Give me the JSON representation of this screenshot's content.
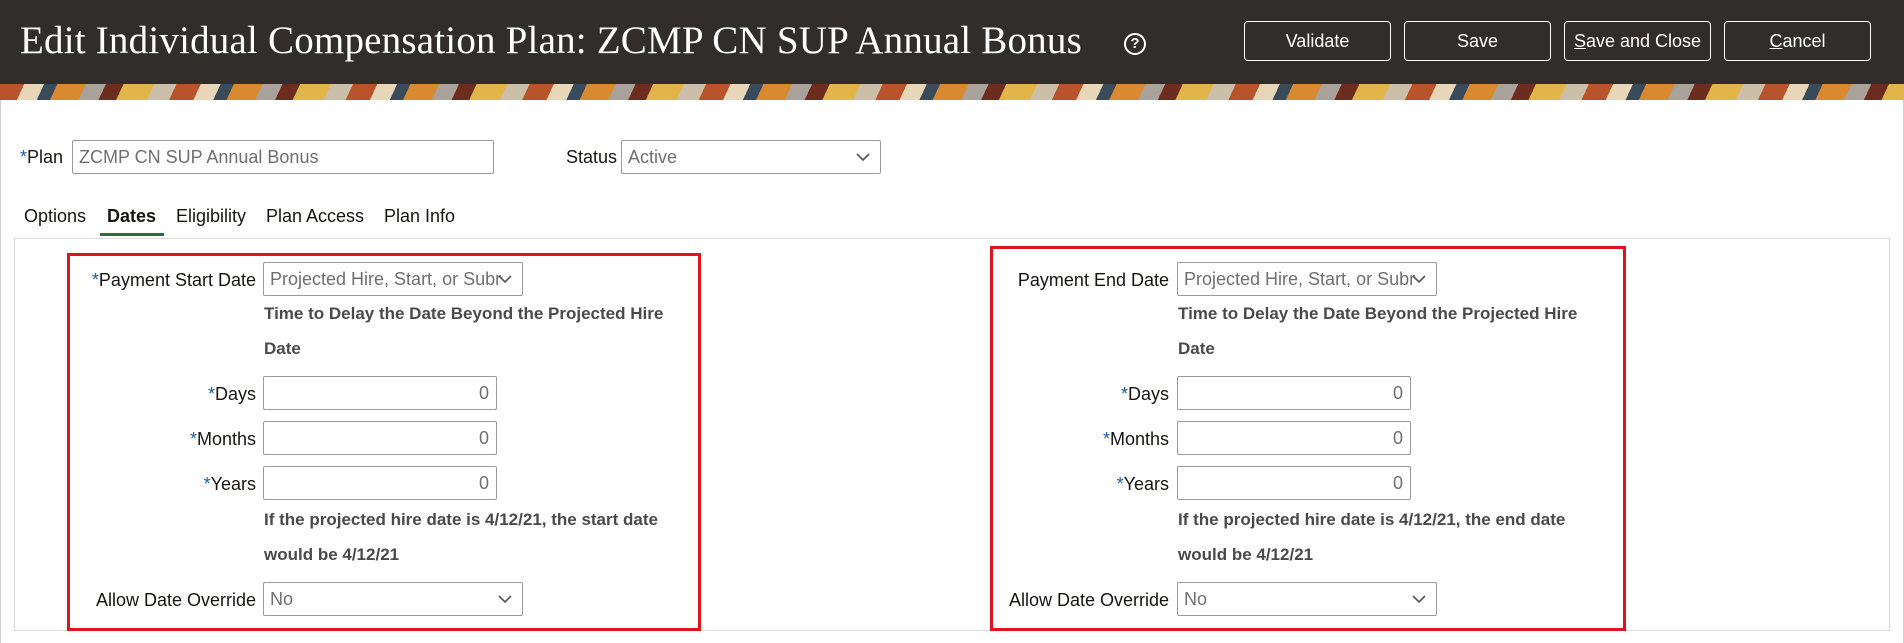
{
  "header": {
    "title": "Edit Individual Compensation Plan: ZCMP CN SUP Annual Bonus",
    "help_symbol": "?",
    "buttons": {
      "validate": "Validate",
      "save": "Save",
      "save_and_close_first": "S",
      "save_and_close_rest": "ave and Close",
      "cancel_first": "C",
      "cancel_rest": "ancel"
    }
  },
  "form": {
    "required_marker": "*",
    "plan_label": "Plan",
    "plan_value": "ZCMP CN SUP Annual Bonus",
    "status_label": "Status",
    "status_value": "Active"
  },
  "tabs": [
    "Options",
    "Dates",
    "Eligibility",
    "Plan Access",
    "Plan Info"
  ],
  "active_tab": "Dates",
  "start_section": {
    "date_label": "Payment Start Date",
    "date_required": true,
    "date_value": "Projected Hire, Start, or Subr",
    "delay_heading_line1": "Time to Delay the Date Beyond the Projected Hire",
    "delay_heading_line2": "Date",
    "days_label": "Days",
    "days_value": "0",
    "months_label": "Months",
    "months_value": "0",
    "years_label": "Years",
    "years_value": "0",
    "example_line1": "If the projected hire date is 4/12/21, the start date",
    "example_line2": "would be 4/12/21",
    "override_label": "Allow Date Override",
    "override_value": "No"
  },
  "end_section": {
    "date_label": "Payment End Date",
    "date_required": false,
    "date_value": "Projected Hire, Start, or Subr",
    "delay_heading_line1": "Time to Delay the Date Beyond the Projected Hire",
    "delay_heading_line2": "Date",
    "days_label": "Days",
    "days_value": "0",
    "months_label": "Months",
    "months_value": "0",
    "years_label": "Years",
    "years_value": "0",
    "example_line1": "If the projected hire date is 4/12/21, the end date",
    "example_line2": "would be 4/12/21",
    "override_label": "Allow Date Override",
    "override_value": "No"
  },
  "colors": {
    "header_bg": "#312d2a",
    "highlight_box": "#e0141e",
    "required_marker": "#1e5aa8",
    "active_tab_underline": "#2f6e3a"
  },
  "icons": [
    "help-icon",
    "chevron-down-icon"
  ]
}
